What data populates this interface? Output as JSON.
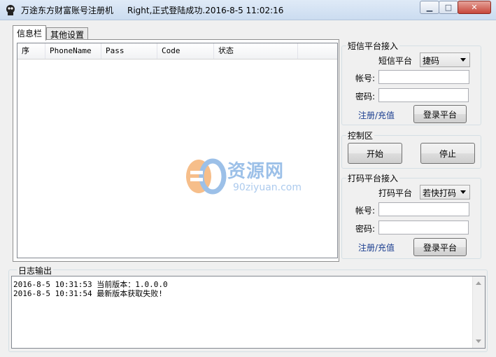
{
  "window": {
    "title": "万途东方财富账号注册机",
    "status": "Right,正式登陆成功.2016-8-5 11:02:16",
    "min_symbol": "▁",
    "max_symbol": "□",
    "close_symbol": "✕"
  },
  "tabs": [
    {
      "label": "信息栏",
      "active": true
    },
    {
      "label": "其他设置",
      "active": false
    }
  ],
  "table": {
    "columns": [
      "序",
      "PhoneName",
      "Pass",
      "Code",
      "状态"
    ],
    "rows": []
  },
  "watermark": {
    "text": "资源网",
    "url": "90ziyuan.com"
  },
  "sms_group": {
    "title": "短信平台接入",
    "platform_label": "短信平台",
    "platform_value": "捷码",
    "account_label": "帐号:",
    "account_value": "",
    "password_label": "密码:",
    "password_value": "",
    "register_link": "注册/充值",
    "login_button": "登录平台"
  },
  "control_group": {
    "title": "控制区",
    "start_button": "开始",
    "stop_button": "停止"
  },
  "captcha_group": {
    "title": "打码平台接入",
    "platform_label": "打码平台",
    "platform_value": "若快打码",
    "account_label": "帐号:",
    "account_value": "",
    "password_label": "密码:",
    "password_value": "",
    "register_link": "注册/充值",
    "login_button": "登录平台"
  },
  "log": {
    "title": "日志输出",
    "lines": [
      "2016-8-5 10:31:53 当前版本：1.0.0.0",
      "2016-8-5 10:31:54 最新版本获取失败!"
    ]
  }
}
